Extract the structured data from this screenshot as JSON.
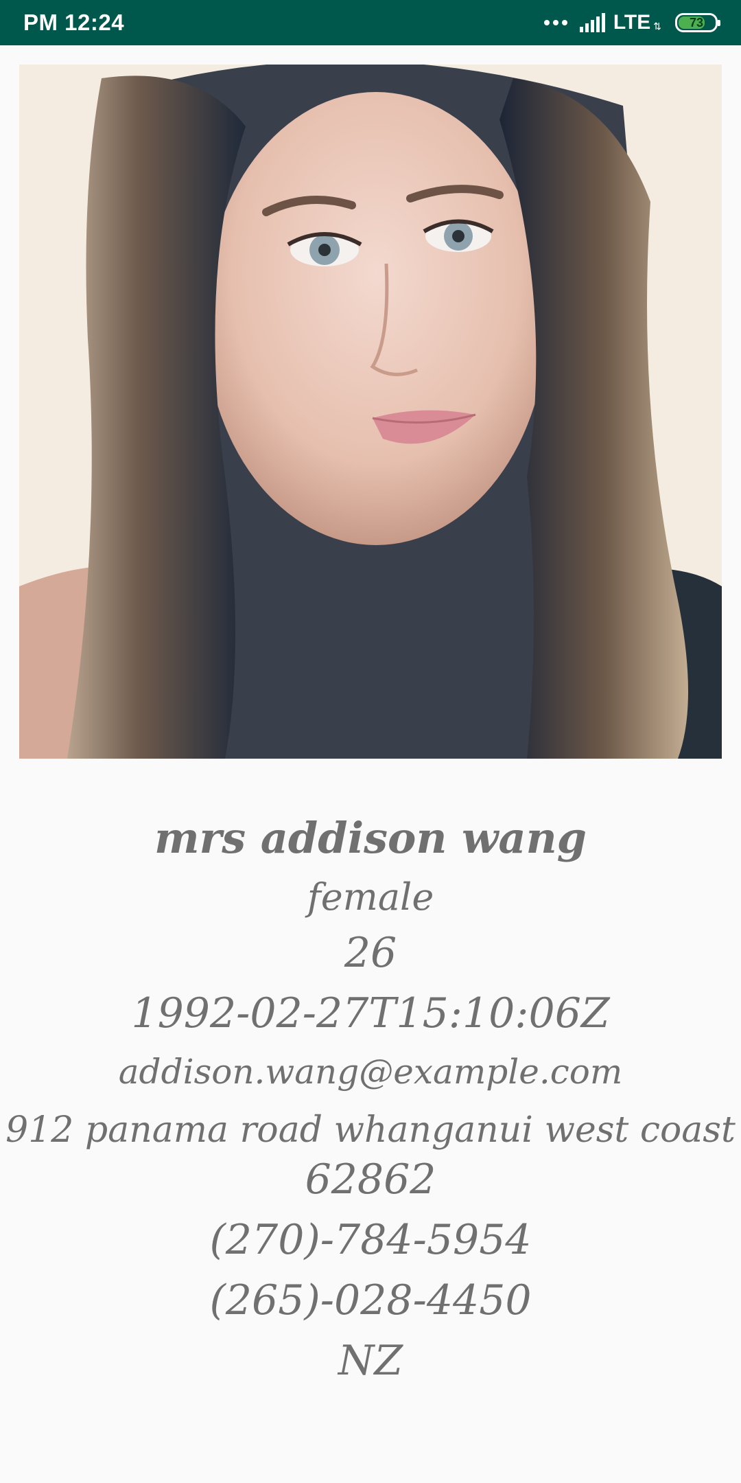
{
  "status_bar": {
    "time": "PM 12:24",
    "network": "LTE",
    "battery": "73",
    "battery_level": 0.73,
    "background": "#00574b",
    "battery_color": "#4caf50"
  },
  "profile": {
    "name": "mrs addison wang",
    "gender": "female",
    "age": "26",
    "dob": "1992-02-27T15:10:06Z",
    "email": "addison.wang@example.com",
    "address": "912 panama road whanganui west coast",
    "postcode": "62862",
    "phone": "(270)-784-5954",
    "cell": "(265)-028-4450",
    "nationality": "NZ"
  },
  "colors": {
    "text": "#707070",
    "page_background": "#fafafa"
  }
}
